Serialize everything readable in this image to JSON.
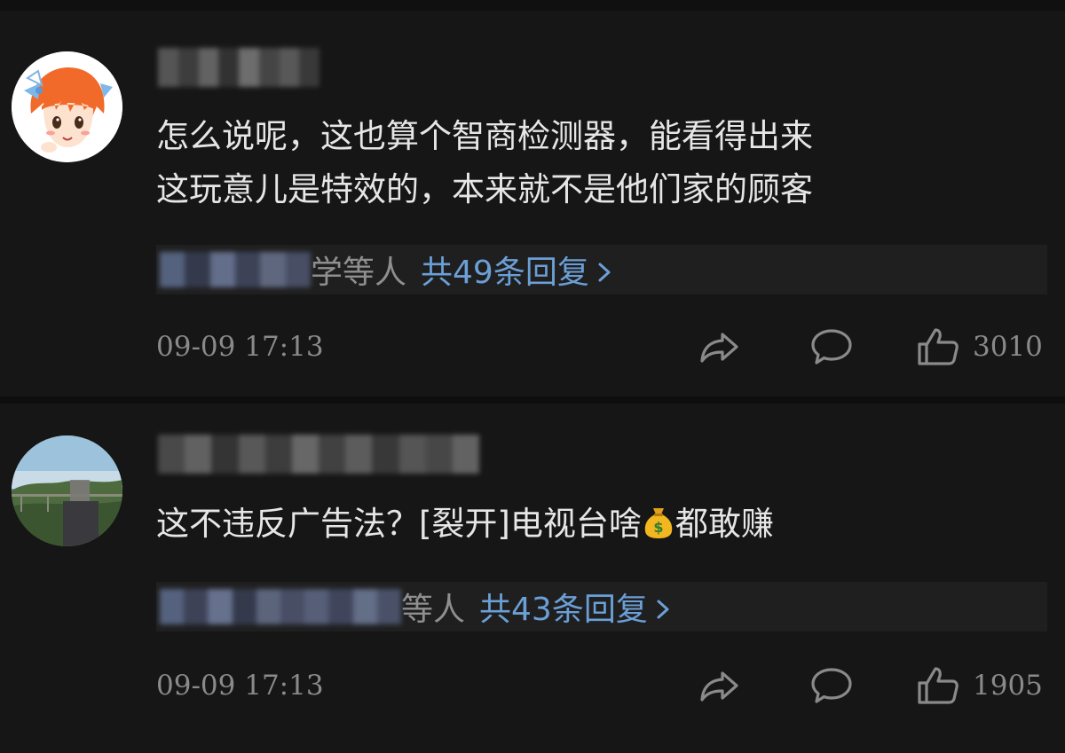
{
  "comments": [
    {
      "body_lines": [
        "怎么说呢，这也算个智商检测器，能看得出来",
        "这玩意儿是特效的，本来就不是他们家的顾客"
      ],
      "reply_suffix": "学等人",
      "reply_link": "共49条回复",
      "timestamp": "09-09 17:13",
      "like_count": "3010"
    },
    {
      "body_before_emoji": "这不违反广告法？[裂开]电视台啥",
      "body_after_emoji": "都敢赚",
      "reply_suffix": "等人",
      "reply_link": "共43条回复",
      "timestamp": "09-09 17:13",
      "like_count": "1905"
    }
  ],
  "icons": {
    "share": "share-arrow-icon",
    "comment": "speech-bubble-icon",
    "like": "thumbs-up-icon",
    "chevron": "chevron-right-icon",
    "emoji": "money-bag-emoji"
  },
  "colors": {
    "background": "#161616",
    "text": "#e6e6e6",
    "muted": "#8a8a8a",
    "link": "#6b9fd6",
    "reply_bar": "#1f1f1f"
  }
}
